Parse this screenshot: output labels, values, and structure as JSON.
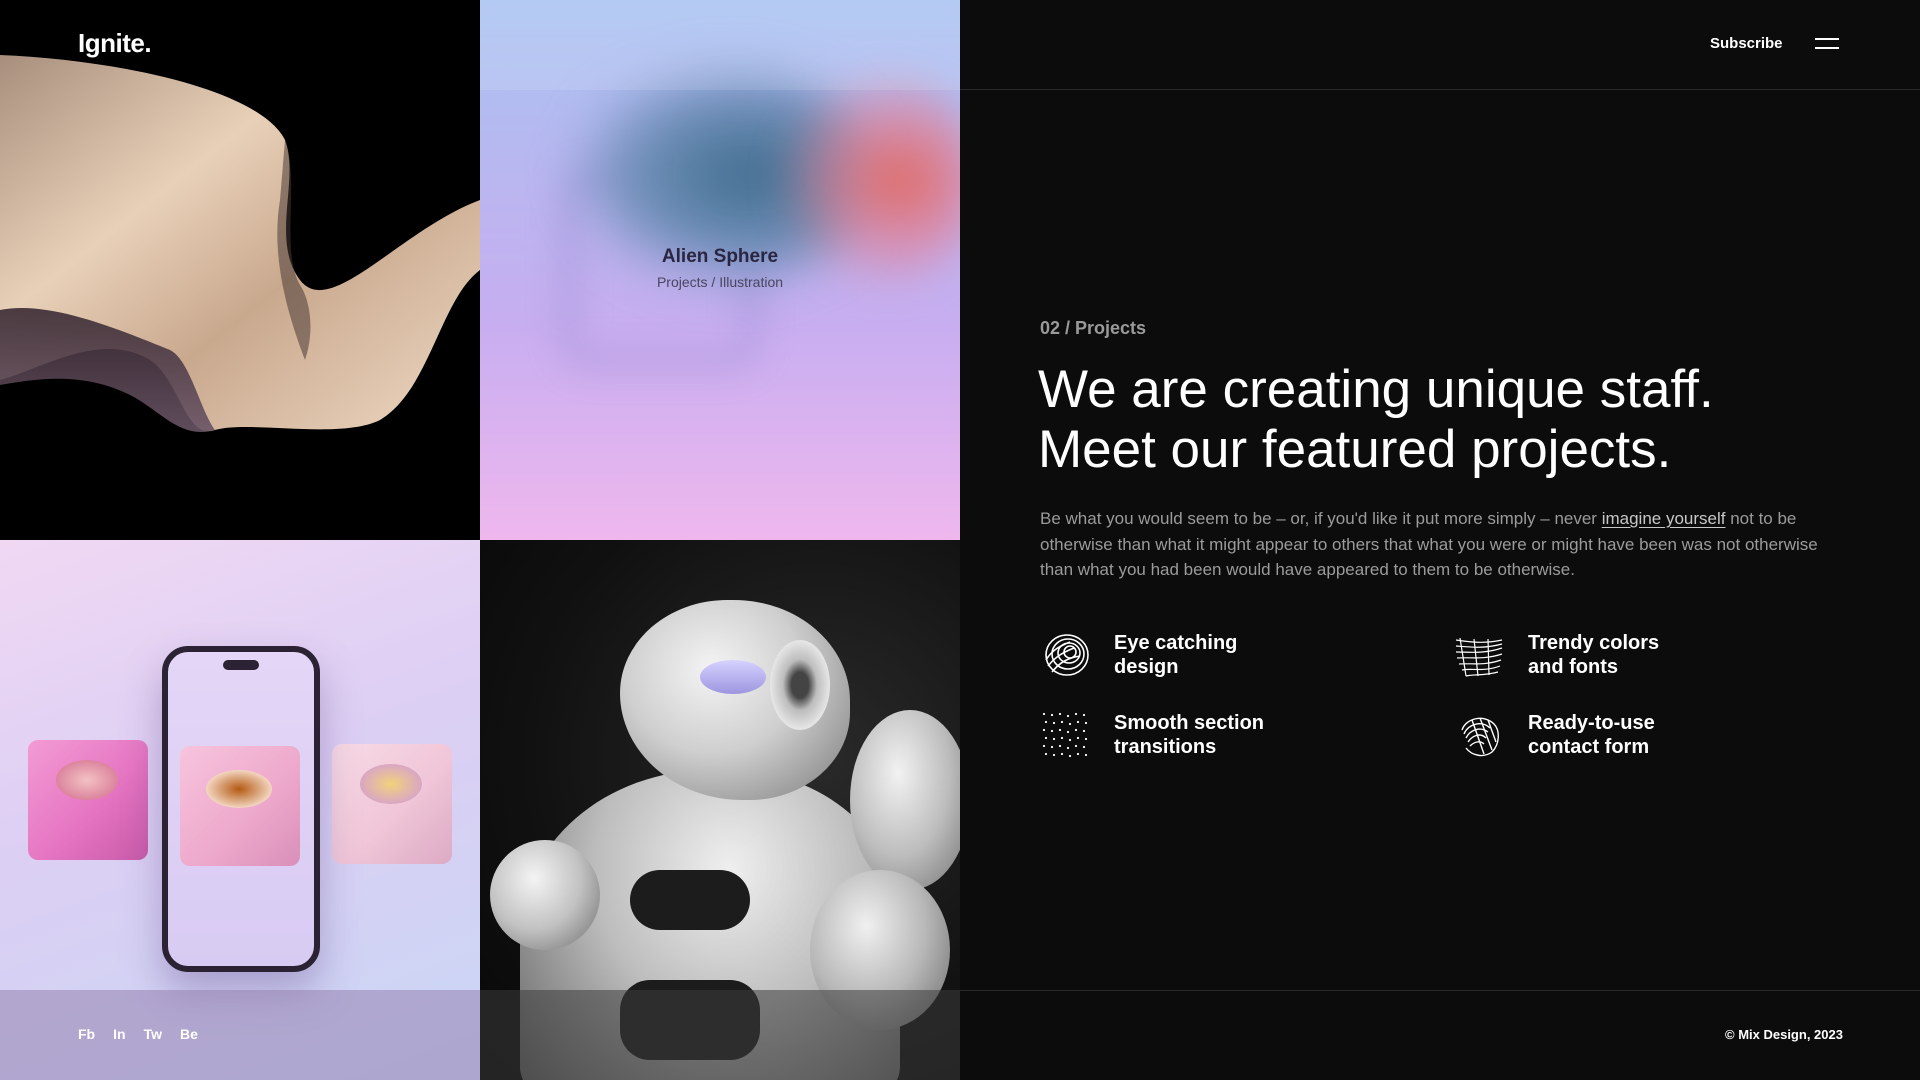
{
  "brand": "Ignite.",
  "header": {
    "subscribe_label": "Subscribe",
    "menu_icon": "hamburger-menu-icon"
  },
  "tiles": {
    "featured": {
      "title": "Alien Sphere",
      "subtitle": "Projects / Illustration"
    }
  },
  "social": [
    "Fb",
    "In",
    "Tw",
    "Be"
  ],
  "main": {
    "eyebrow": "02 / Projects",
    "headline_line1": "We are creating unique staff.",
    "headline_line2": "Meet our featured projects.",
    "lede_before": "Be what you would seem to be – or, if you'd like it put more simply – never ",
    "lede_link": "imagine yourself",
    "lede_after": " not to be otherwise than what it might appear to others that what you were or might have been was not otherwise than what you had been would have appeared to them to be otherwise.",
    "features": [
      {
        "line1": "Eye catching",
        "line2": "design",
        "icon": "spiral-icon"
      },
      {
        "line1": "Trendy colors",
        "line2": "and fonts",
        "icon": "fan-icon"
      },
      {
        "line1": "Smooth section",
        "line2": "transitions",
        "icon": "dot-grid-icon"
      },
      {
        "line1": "Ready-to-use",
        "line2": "contact form",
        "icon": "shell-icon"
      }
    ]
  },
  "footer": {
    "copyright": "© Mix Design, 2023"
  },
  "colors": {
    "background": "#0c0c0c",
    "text": "#ffffff",
    "muted": "#9b9b9b",
    "rule": "#2a2a2a"
  }
}
